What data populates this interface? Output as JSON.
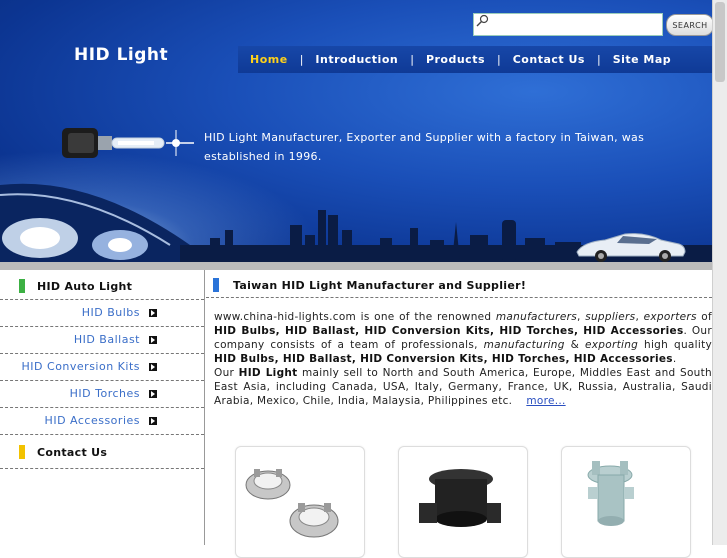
{
  "header": {
    "site_title": "HID Light",
    "search_placeholder": "",
    "search_button": "SEARCH",
    "tagline": "HID Light Manufacturer, Exporter and Supplier with a factory in Taiwan, was established in 1996."
  },
  "nav": {
    "items": [
      {
        "label": "Home",
        "active": true
      },
      {
        "label": "Introduction"
      },
      {
        "label": "Products"
      },
      {
        "label": "Contact Us"
      },
      {
        "label": "Site Map"
      }
    ],
    "separator": "|"
  },
  "sidebar": {
    "section1": "HID Auto Light",
    "items": [
      {
        "label": "HID Bulbs"
      },
      {
        "label": "HID Ballast"
      },
      {
        "label": "HID Conversion Kits"
      },
      {
        "label": "HID Torches"
      },
      {
        "label": "HID Accessories"
      }
    ],
    "section2": "Contact Us"
  },
  "main": {
    "heading": "Taiwan HID Light Manufacturer and Supplier!",
    "p1_a": "www.china-hid-lights.com is one of the renowned ",
    "p1_b": "manufacturers",
    "p1_c": ", ",
    "p1_d": "suppliers",
    "p1_e": ", ",
    "p1_f": "exporters",
    "p1_g": " of ",
    "p1_h": "HID Bulbs, HID Ballast, HID Conversion Kits, HID Torches, HID Accessories",
    "p1_i": ". Our company consists of a team of professionals, ",
    "p1_j": "manufacturing",
    "p1_k": " & ",
    "p1_l": "exporting",
    "p1_m": " high quality ",
    "p1_n": "HID Bulbs, HID Ballast, HID Conversion Kits, HID Torches, HID Accessories",
    "p1_o": ".",
    "p2_a": "Our ",
    "p2_b": "HID Light",
    "p2_c": " mainly sell to North and South America, Europe, Middles East and South East Asia, including Canada, USA, Italy, Germany, France, UK, Russia, Australia, Saudi Arabia, Mexico, Chile, India, Malaysia, Philippines etc.",
    "more": "more..."
  },
  "colors": {
    "banner": "#1a4fb8",
    "nav_active": "#ffd21a",
    "sidebar_link": "#3a6ec8",
    "marker_green": "#3cb043",
    "marker_yellow": "#f2c200",
    "marker_blue": "#2a73d8"
  }
}
